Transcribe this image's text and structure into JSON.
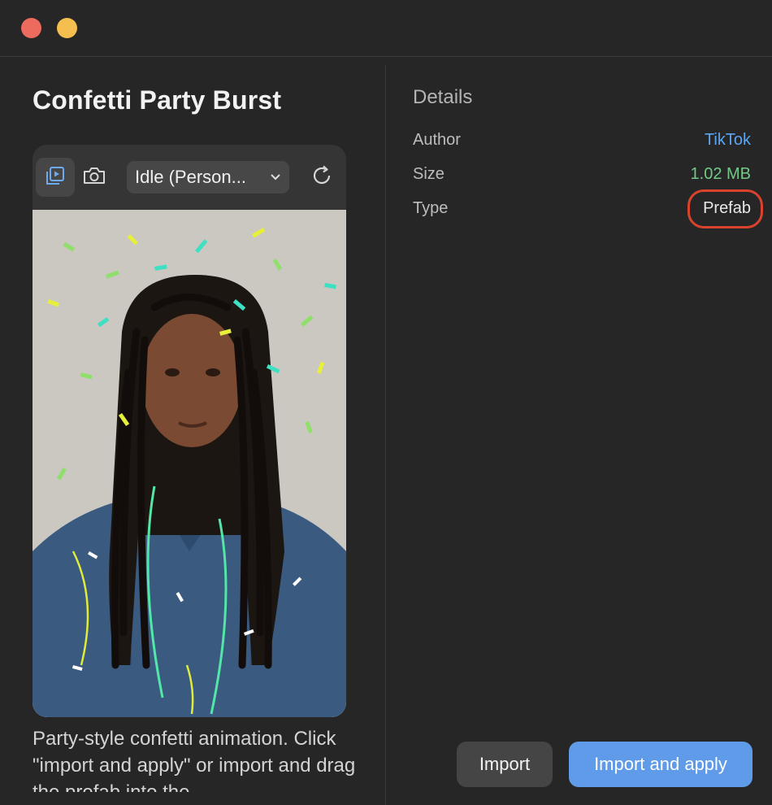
{
  "window": {
    "close_color": "#ec6a5e",
    "minimize_color": "#f4bf4f"
  },
  "effect": {
    "title": "Confetti Party Burst",
    "description": "Party-style confetti animation. Click \"import and apply\" or import and drag the prefab into the"
  },
  "preview_toolbar": {
    "play_icon": "play-preview-icon",
    "camera_icon": "camera-icon",
    "dropdown_value": "Idle (Person...",
    "refresh_icon": "refresh-icon"
  },
  "details": {
    "heading": "Details",
    "rows": [
      {
        "label": "Author",
        "value": "TikTok"
      },
      {
        "label": "Size",
        "value": "1.02 MB"
      },
      {
        "label": "Type",
        "value": "Prefab"
      }
    ]
  },
  "actions": {
    "import_label": "Import",
    "import_apply_label": "Import and apply"
  },
  "colors": {
    "accent_blue": "#5f9be8",
    "author_link": "#5aa6f5",
    "size_green": "#73c986",
    "highlight_red": "#d9432d"
  }
}
